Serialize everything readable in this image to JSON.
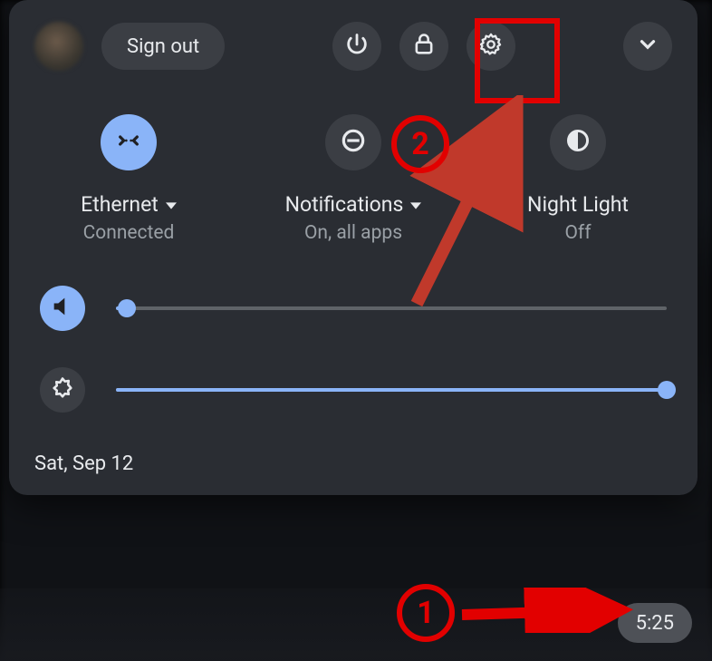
{
  "header": {
    "sign_out_label": "Sign out"
  },
  "tiles": {
    "network": {
      "title": "Ethernet",
      "sub": "Connected"
    },
    "notifications": {
      "title": "Notifications",
      "sub": "On, all apps"
    },
    "night_light": {
      "title": "Night Light",
      "sub": "Off"
    }
  },
  "sliders": {
    "volume_percent": 2,
    "brightness_percent": 100
  },
  "date_text": "Sat, Sep 12",
  "shelf": {
    "clock": "5:25"
  },
  "annotations": {
    "marker1": "1",
    "marker2": "2"
  }
}
